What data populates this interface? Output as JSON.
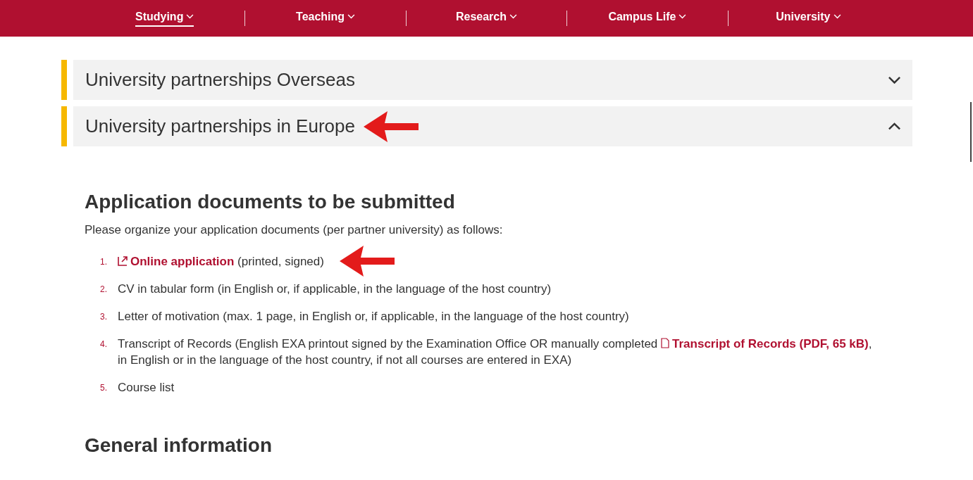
{
  "nav": [
    {
      "label": "Studying",
      "selected": true
    },
    {
      "label": "Teaching",
      "selected": false
    },
    {
      "label": "Research",
      "selected": false
    },
    {
      "label": "Campus Life",
      "selected": false
    },
    {
      "label": "University",
      "selected": false
    }
  ],
  "accordion": [
    {
      "title": "University partnerships Overseas",
      "expanded": false,
      "annotated": false
    },
    {
      "title": "University partnerships in Europe",
      "expanded": true,
      "annotated": true
    }
  ],
  "section": {
    "heading": "Application documents to be submitted",
    "intro": "Please organize your application documents (per partner university) as follows:",
    "items": [
      {
        "number": "1.",
        "annotated": true,
        "parts": [
          {
            "kind": "external-link",
            "text": "Online application"
          },
          {
            "kind": "text",
            "text": " (printed, signed)"
          }
        ]
      },
      {
        "number": "2.",
        "annotated": false,
        "parts": [
          {
            "kind": "text",
            "text": "CV in tabular form (in English or, if applicable, in the language of the host country)"
          }
        ]
      },
      {
        "number": "3.",
        "annotated": false,
        "parts": [
          {
            "kind": "text",
            "text": "Letter of motivation (max. 1 page, in English or, if applicable, in the language of the host country)"
          }
        ]
      },
      {
        "number": "4.",
        "annotated": false,
        "parts": [
          {
            "kind": "text",
            "text": "Transcript of Records (English EXA printout signed by the Examination Office OR manually completed "
          },
          {
            "kind": "file-link",
            "text": "Transcript of Records (PDF, 65 kB)"
          },
          {
            "kind": "text",
            "text": ", in English or in the language of the host country, if not all courses are entered in EXA)"
          }
        ]
      },
      {
        "number": "5.",
        "annotated": false,
        "parts": [
          {
            "kind": "text",
            "text": "Course list"
          }
        ]
      }
    ]
  },
  "next_heading": "General information"
}
